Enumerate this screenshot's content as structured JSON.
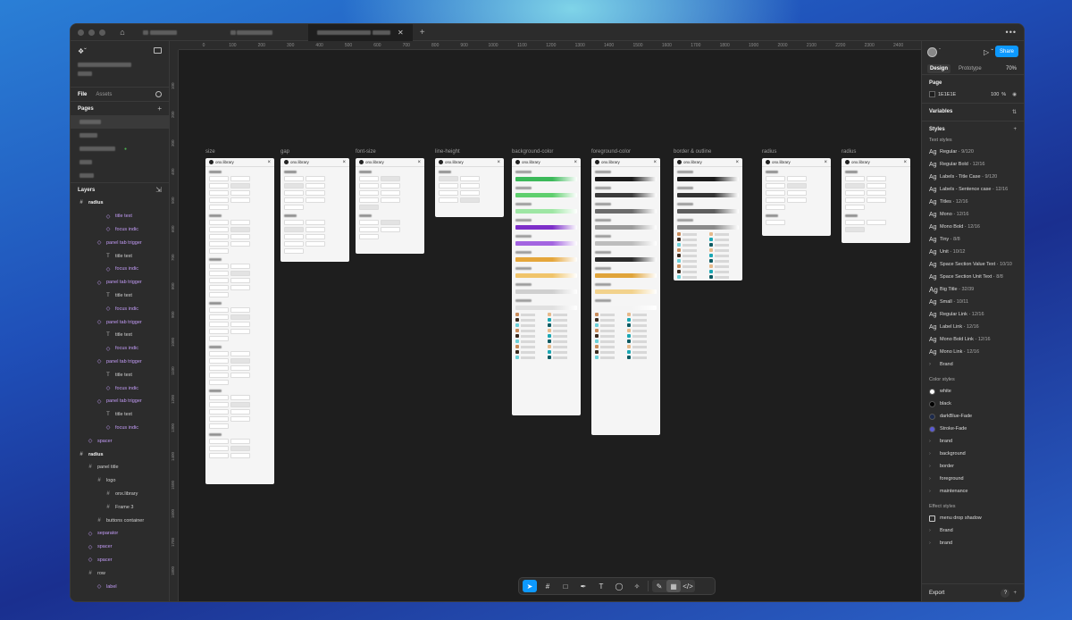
{
  "window": {
    "tab_close": "✕",
    "tab_add": "+",
    "more": "•••"
  },
  "left_panel": {
    "tabs": [
      "File",
      "Assets"
    ],
    "pages_header": "Pages",
    "layers_header": "Layers",
    "layers": [
      {
        "label": "radius",
        "kind": "frame",
        "indent": 0
      },
      {
        "label": "title text",
        "kind": "comp",
        "indent": 3
      },
      {
        "label": "focus indic",
        "kind": "comp",
        "indent": 3
      },
      {
        "label": "panel tab trigger",
        "kind": "comp",
        "indent": 2
      },
      {
        "label": "title text",
        "kind": "text",
        "indent": 3
      },
      {
        "label": "focus indic",
        "kind": "comp",
        "indent": 3
      },
      {
        "label": "panel tab trigger",
        "kind": "comp",
        "indent": 2
      },
      {
        "label": "title text",
        "kind": "text",
        "indent": 3
      },
      {
        "label": "focus indic",
        "kind": "comp",
        "indent": 3
      },
      {
        "label": "panel tab trigger",
        "kind": "comp",
        "indent": 2
      },
      {
        "label": "title text",
        "kind": "text",
        "indent": 3
      },
      {
        "label": "focus indic",
        "kind": "comp",
        "indent": 3
      },
      {
        "label": "panel tab trigger",
        "kind": "comp",
        "indent": 2
      },
      {
        "label": "title text",
        "kind": "text",
        "indent": 3
      },
      {
        "label": "focus indic",
        "kind": "comp",
        "indent": 3
      },
      {
        "label": "panel tab trigger",
        "kind": "comp",
        "indent": 2
      },
      {
        "label": "title text",
        "kind": "text",
        "indent": 3
      },
      {
        "label": "focus indic",
        "kind": "comp",
        "indent": 3
      },
      {
        "label": "spacer",
        "kind": "comp",
        "indent": 1
      },
      {
        "label": "radius",
        "kind": "frame",
        "indent": 0
      },
      {
        "label": "panel title",
        "kind": "frame",
        "indent": 1
      },
      {
        "label": "logo",
        "kind": "frame",
        "indent": 2
      },
      {
        "label": "onx.library",
        "kind": "frame",
        "indent": 3
      },
      {
        "label": "Frame 3",
        "kind": "frame",
        "indent": 3
      },
      {
        "label": "buttons container",
        "kind": "frame",
        "indent": 2
      },
      {
        "label": "separator",
        "kind": "comp",
        "indent": 1
      },
      {
        "label": "spacer",
        "kind": "comp",
        "indent": 1
      },
      {
        "label": "spacer",
        "kind": "comp",
        "indent": 1
      },
      {
        "label": "row",
        "kind": "frame",
        "indent": 1
      },
      {
        "label": "label",
        "kind": "comp",
        "indent": 2
      }
    ]
  },
  "rulers": {
    "top": [
      "0",
      "100",
      "200",
      "300",
      "400",
      "500",
      "600",
      "700",
      "800",
      "900",
      "1000",
      "1100",
      "1200",
      "1300",
      "1400",
      "1500",
      "1600",
      "1700",
      "1800",
      "1900",
      "2000",
      "2100",
      "2200",
      "2300",
      "2400"
    ],
    "left": [
      "100",
      "200",
      "300",
      "400",
      "500",
      "600",
      "700",
      "800",
      "900",
      "1000",
      "1100",
      "1200",
      "1300",
      "1400",
      "1500",
      "1600",
      "1700",
      "1800"
    ]
  },
  "canvas": {
    "frames": [
      {
        "label": "size",
        "title": "onx.library"
      },
      {
        "label": "gap",
        "title": "onx.library"
      },
      {
        "label": "font-size",
        "title": "onx.library"
      },
      {
        "label": "line-height",
        "title": "onx.library"
      },
      {
        "label": "background-color",
        "title": "onx.library"
      },
      {
        "label": "foreground-color",
        "title": "onx.library"
      },
      {
        "label": "border & outline",
        "title": "onx.library"
      },
      {
        "label": "radius",
        "title": "onx.library"
      },
      {
        "label": "radius",
        "title": "onx.library"
      }
    ]
  },
  "toolbar": {
    "tools": [
      "move-tool",
      "frame-tool",
      "shape-tool",
      "pen-tool",
      "text-tool",
      "comment-tool",
      "actions-tool",
      "draw-mode",
      "design-mode",
      "dev-mode"
    ]
  },
  "right_panel": {
    "share_label": "Share",
    "tabs": [
      "Design",
      "Prototype"
    ],
    "zoom": "70%",
    "page_header": "Page",
    "page_color": "1E1E1E",
    "page_opacity": "100",
    "page_opacity_unit": "%",
    "variables_header": "Variables",
    "styles_header": "Styles",
    "text_styles_header": "Text styles",
    "text_styles": [
      {
        "name": "Regular",
        "size": "9/120",
        "glyph": "Ag"
      },
      {
        "name": "Regular Bold",
        "size": "12/16",
        "glyph": "Ag"
      },
      {
        "name": "Labels - Title Case",
        "size": "9/120",
        "glyph": "Ag"
      },
      {
        "name": "Labels - Sentence case",
        "size": "12/16",
        "glyph": "Ag"
      },
      {
        "name": "Titles",
        "size": "12/16",
        "glyph": "Ag"
      },
      {
        "name": "Mono",
        "size": "12/16",
        "glyph": "Ag"
      },
      {
        "name": "Mono Bold",
        "size": "12/16",
        "glyph": "Ag"
      },
      {
        "name": "Tiny",
        "size": "8/8",
        "glyph": "Ag"
      },
      {
        "name": "Unit",
        "size": "10/12",
        "glyph": "Ag"
      },
      {
        "name": "Space Section Value Text",
        "size": "10/10",
        "glyph": "Ag"
      },
      {
        "name": "Space Section Unit Text",
        "size": "8/8",
        "glyph": "Ag"
      },
      {
        "name": "Big Title",
        "size": "32/39",
        "glyph": "Ag"
      },
      {
        "name": "Small",
        "size": "10/11",
        "glyph": "Ag"
      },
      {
        "name": "Regular Link",
        "size": "12/16",
        "glyph": "Ag"
      },
      {
        "name": "Label Link",
        "size": "12/16",
        "glyph": "Ag"
      },
      {
        "name": "Mono Bold Link",
        "size": "12/16",
        "glyph": "Ag"
      },
      {
        "name": "Mono Link",
        "size": "12/16",
        "glyph": "Ag"
      },
      {
        "name": "Brand",
        "size": "",
        "glyph": "›"
      }
    ],
    "color_styles_header": "Color styles",
    "color_styles": [
      {
        "name": "white",
        "color": "#ffffff",
        "folder": false
      },
      {
        "name": "black",
        "color": "#000000",
        "folder": false
      },
      {
        "name": "darkBlue-Fade",
        "color": "#1c2a4d",
        "folder": false
      },
      {
        "name": "Stroke-Fade",
        "color": "#5b5bd6",
        "folder": false
      },
      {
        "name": "brand",
        "color": "",
        "folder": true
      },
      {
        "name": "background",
        "color": "",
        "folder": true
      },
      {
        "name": "border",
        "color": "",
        "folder": true
      },
      {
        "name": "foreground",
        "color": "",
        "folder": true
      },
      {
        "name": "maintenance",
        "color": "",
        "folder": true
      }
    ],
    "effect_styles_header": "Effect styles",
    "effect_styles": [
      {
        "name": "menu drop shadow",
        "folder": false
      },
      {
        "name": "Brand",
        "folder": true
      },
      {
        "name": "brand",
        "folder": true
      }
    ],
    "export_label": "Export",
    "help": "?"
  },
  "colors": {
    "accent": "#0d99ff",
    "component": "#c39cf7",
    "canvas": "#1e1e1e",
    "panel": "#2c2c2c"
  }
}
